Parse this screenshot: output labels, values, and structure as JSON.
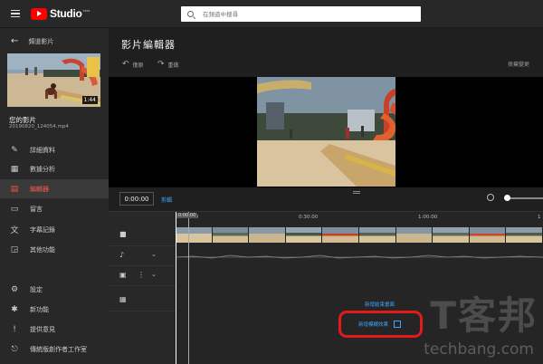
{
  "app": {
    "logo_text": "Studio",
    "logo_superscript": "beta"
  },
  "search": {
    "placeholder": "在頻道中搜尋"
  },
  "sidebar": {
    "back_label": "頻道影片",
    "thumbnail_duration": "1:44",
    "video_title": "您的影片",
    "video_filename": "20190820_124054.mp4",
    "items": [
      {
        "label": "詳細資料",
        "icon": "pencil-icon"
      },
      {
        "label": "數據分析",
        "icon": "analytics-icon"
      },
      {
        "label": "編輯器",
        "icon": "film-icon",
        "active": true
      },
      {
        "label": "留言",
        "icon": "comment-icon"
      },
      {
        "label": "字幕記錄",
        "icon": "translate-icon"
      },
      {
        "label": "其他功能",
        "icon": "other-features-icon"
      }
    ],
    "bottom_items": [
      {
        "label": "設定",
        "icon": "gear-icon"
      },
      {
        "label": "新功能",
        "icon": "new-features-icon"
      },
      {
        "label": "提供意見",
        "icon": "feedback-icon"
      },
      {
        "label": "傳統版創作者工作室",
        "icon": "classic-studio-icon"
      }
    ]
  },
  "editor": {
    "title": "影片編輯器",
    "undo_label": "復原",
    "redo_label": "重做",
    "discard_label": "捨棄變更",
    "timecode": "0:00:00",
    "trim_label": "剪輯",
    "playhead_time": "0:00:00",
    "ruler_ticks": [
      "0:00:00",
      "0:30:00",
      "1:00:00",
      "1"
    ],
    "add_end_screen": "新增結束畫面",
    "add_blur": "新增模糊效果"
  },
  "colors": {
    "accent_blue": "#3ea6ff",
    "brand_red": "#ff0000",
    "highlight_red": "#e21a1a",
    "active_nav": "#ff5a4d"
  },
  "watermark": {
    "chinese": "T客邦",
    "latin": "techbang.com"
  }
}
